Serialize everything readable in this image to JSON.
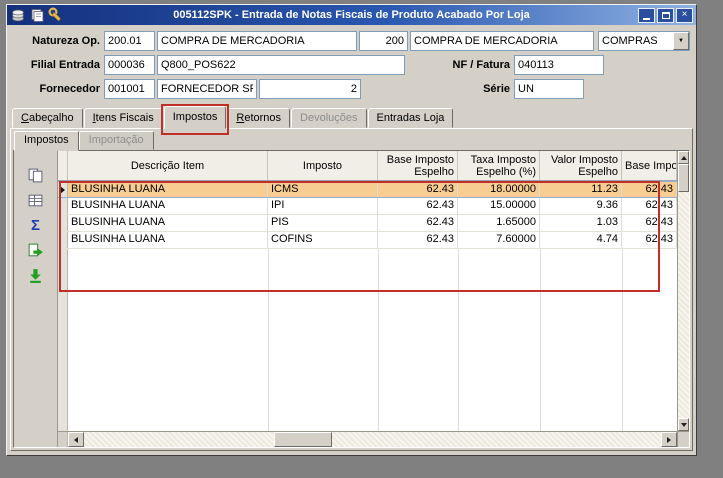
{
  "window": {
    "title": "005112SPK - Entrada de Notas Fiscais de Produto Acabado Por Loja"
  },
  "icons": {
    "sum": "Σ",
    "close": "×",
    "dropdown": "▼"
  },
  "form": {
    "natureza": {
      "label": "Natureza Op.",
      "code": "200.01",
      "description": "COMPRA DE MERCADORIA",
      "group_code": "200",
      "group_description": "COMPRA DE MERCADORIA",
      "type": "COMPRAS"
    },
    "filial": {
      "label": "Filial Entrada",
      "code": "000036",
      "description": "Q800_POS622"
    },
    "nf_fatura": {
      "label": "NF / Fatura",
      "value": "040113"
    },
    "fornecedor": {
      "label": "Fornecedor",
      "code": "001001",
      "description": "FORNECEDOR SP",
      "loja": "2"
    },
    "serie": {
      "label": "Série",
      "value": "UN"
    }
  },
  "tabs": [
    {
      "label": "Cabeçalho",
      "state": "normal"
    },
    {
      "label": "Itens Fiscais",
      "state": "normal"
    },
    {
      "label": "Impostos",
      "state": "active"
    },
    {
      "label": "Retornos",
      "state": "normal"
    },
    {
      "label": "Devoluções",
      "state": "disabled"
    },
    {
      "label": "Entradas Loja",
      "state": "normal"
    }
  ],
  "subtabs": [
    {
      "label": "Impostos",
      "state": "active"
    },
    {
      "label": "Importação",
      "state": "disabled"
    }
  ],
  "grid": {
    "columns": [
      "Descrição Item",
      "Imposto",
      "Base Imposto Espelho",
      "Taxa Imposto Espelho (%)",
      "Valor Imposto Espelho",
      "Base Impos"
    ],
    "rows": [
      {
        "descricao": "BLUSINHA LUANA",
        "imposto": "ICMS",
        "base_espelho": "62.43",
        "taxa_espelho": "18.00000",
        "valor_espelho": "11.23",
        "base_2": "62.43",
        "selected": true
      },
      {
        "descricao": "BLUSINHA LUANA",
        "imposto": "IPI",
        "base_espelho": "62.43",
        "taxa_espelho": "15.00000",
        "valor_espelho": "9.36",
        "base_2": "62.43",
        "selected": false
      },
      {
        "descricao": "BLUSINHA LUANA",
        "imposto": "PIS",
        "base_espelho": "62.43",
        "taxa_espelho": "1.65000",
        "valor_espelho": "1.03",
        "base_2": "62.43",
        "selected": false
      },
      {
        "descricao": "BLUSINHA LUANA",
        "imposto": "COFINS",
        "base_espelho": "62.43",
        "taxa_espelho": "7.60000",
        "valor_espelho": "4.74",
        "base_2": "62.43",
        "selected": false
      }
    ]
  },
  "colors": {
    "selected_row": "#f8cd92",
    "annotation_red": "#c03028",
    "titlebar_blue": "#2a57b0"
  }
}
